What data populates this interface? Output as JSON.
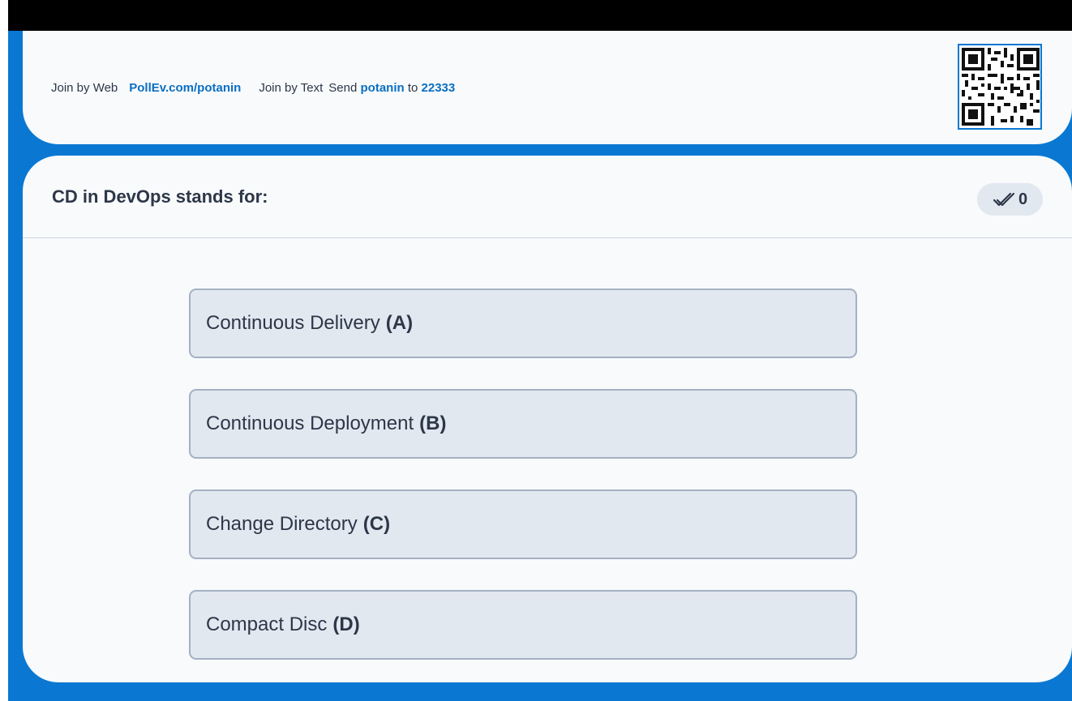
{
  "join": {
    "web_label": "Join by Web",
    "web_url": "PollEv.com/potanin",
    "text_label": "Join by Text",
    "send_label": "Send",
    "keyword": "potanin",
    "to_label": "to",
    "number": "22333"
  },
  "poll": {
    "question": "CD in DevOps stands for:",
    "response_count": "0",
    "options": [
      {
        "text": "Continuous Delivery",
        "letter": "(A)"
      },
      {
        "text": "Continuous Deployment",
        "letter": "(B)"
      },
      {
        "text": "Change Directory",
        "letter": "(C)"
      },
      {
        "text": "Compact Disc",
        "letter": "(D)"
      }
    ]
  },
  "colors": {
    "brand_blue": "#0a78d2",
    "link_blue": "#0a6fc2",
    "card_bg": "#f8fafc",
    "option_bg": "#e2e8f0",
    "option_border": "#a5b1c2",
    "text": "#2d3748"
  },
  "icons": {
    "qr": "qr-code-icon",
    "responses": "double-check-icon"
  }
}
